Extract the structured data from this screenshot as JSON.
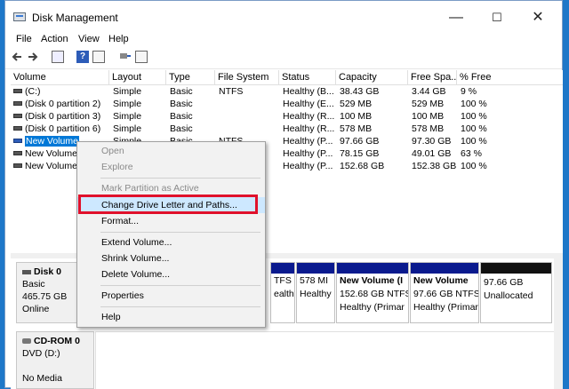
{
  "window": {
    "title": "Disk Management",
    "min": "—",
    "max": "☐",
    "close": "✕"
  },
  "menu": [
    "File",
    "Action",
    "View",
    "Help"
  ],
  "columns": [
    "Volume",
    "Layout",
    "Type",
    "File System",
    "Status",
    "Capacity",
    "Free Spa...",
    "% Free"
  ],
  "volumes": [
    {
      "volume": "(C:)",
      "layout": "Simple",
      "type": "Basic",
      "fs": "NTFS",
      "status": "Healthy (B...",
      "capacity": "38.43 GB",
      "free": "3.44 GB",
      "pct": "9 %"
    },
    {
      "volume": "(Disk 0 partition 2)",
      "layout": "Simple",
      "type": "Basic",
      "fs": "",
      "status": "Healthy (E...",
      "capacity": "529 MB",
      "free": "529 MB",
      "pct": "100 %"
    },
    {
      "volume": "(Disk 0 partition 3)",
      "layout": "Simple",
      "type": "Basic",
      "fs": "",
      "status": "Healthy (R...",
      "capacity": "100 MB",
      "free": "100 MB",
      "pct": "100 %"
    },
    {
      "volume": "(Disk 0 partition 6)",
      "layout": "Simple",
      "type": "Basic",
      "fs": "",
      "status": "Healthy (R...",
      "capacity": "578 MB",
      "free": "578 MB",
      "pct": "100 %"
    },
    {
      "volume": "New Volume",
      "layout": "Simple",
      "type": "Basic",
      "fs": "NTFS",
      "status": "Healthy (P...",
      "capacity": "97.66 GB",
      "free": "97.30 GB",
      "pct": "100 %"
    },
    {
      "volume": "New Volume",
      "layout": "",
      "type": "",
      "fs": "",
      "status": "Healthy (P...",
      "capacity": "78.15 GB",
      "free": "49.01 GB",
      "pct": "63 %"
    },
    {
      "volume": "New Volume",
      "layout": "",
      "type": "",
      "fs": "",
      "status": "Healthy (P...",
      "capacity": "152.68 GB",
      "free": "152.38 GB",
      "pct": "100 %"
    }
  ],
  "disk0": {
    "name": "Disk 0",
    "type": "Basic",
    "size": "465.75 GB",
    "status": "Online"
  },
  "cdrom0": {
    "name": "CD-ROM 0",
    "drive": "DVD (D:)",
    "media": "No Media"
  },
  "partitions": [
    {
      "l1": "TFS",
      "l2": "ealthy (B",
      "l3": ""
    },
    {
      "l1": "578 MI",
      "l2": "Healthy",
      "l3": ""
    },
    {
      "l1": "New Volume  (I",
      "l2": "152.68 GB NTFS",
      "l3": "Healthy (Primar"
    },
    {
      "l1": "New Volume",
      "l2": "97.66 GB NTFS",
      "l3": "Healthy (Primar"
    },
    {
      "l1": "",
      "l2": "97.66 GB",
      "l3": "Unallocated"
    }
  ],
  "context_menu": {
    "open": "Open",
    "explore": "Explore",
    "mark_active": "Mark Partition as Active",
    "change_letter": "Change Drive Letter and Paths...",
    "format": "Format...",
    "extend": "Extend Volume...",
    "shrink": "Shrink Volume...",
    "delete": "Delete Volume...",
    "properties": "Properties",
    "help": "Help"
  },
  "colors": {
    "primary_partition": "#0a1a8e",
    "unallocated": "#111111",
    "highlight": "#e0112b",
    "selection": "#0078d7"
  }
}
